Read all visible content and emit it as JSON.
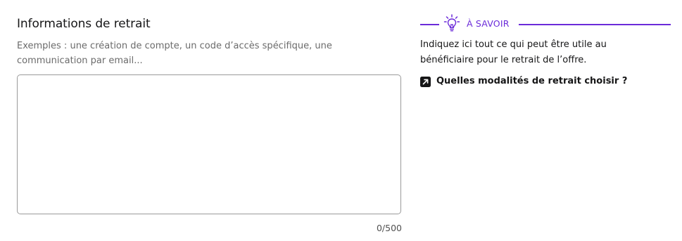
{
  "field": {
    "label": "Informations de retrait",
    "description": "Exemples : une création de compte, un code d’accès spécifique, une communication par email...",
    "value": "",
    "placeholder": "",
    "counter": "0/500"
  },
  "callout": {
    "title": "À SAVOIR",
    "text": "Indiquez ici tout ce qui peut être utile au bénéficiaire pour le retrait de l’offre.",
    "link_label": "Quelles modalités de retrait choisir ?",
    "icon": "lightbulb-icon",
    "link_icon": "external-link-icon"
  },
  "colors": {
    "accent": "#6b2bd9",
    "text": "#161617",
    "muted": "#6b6b6b",
    "border": "#9a9a9a"
  }
}
